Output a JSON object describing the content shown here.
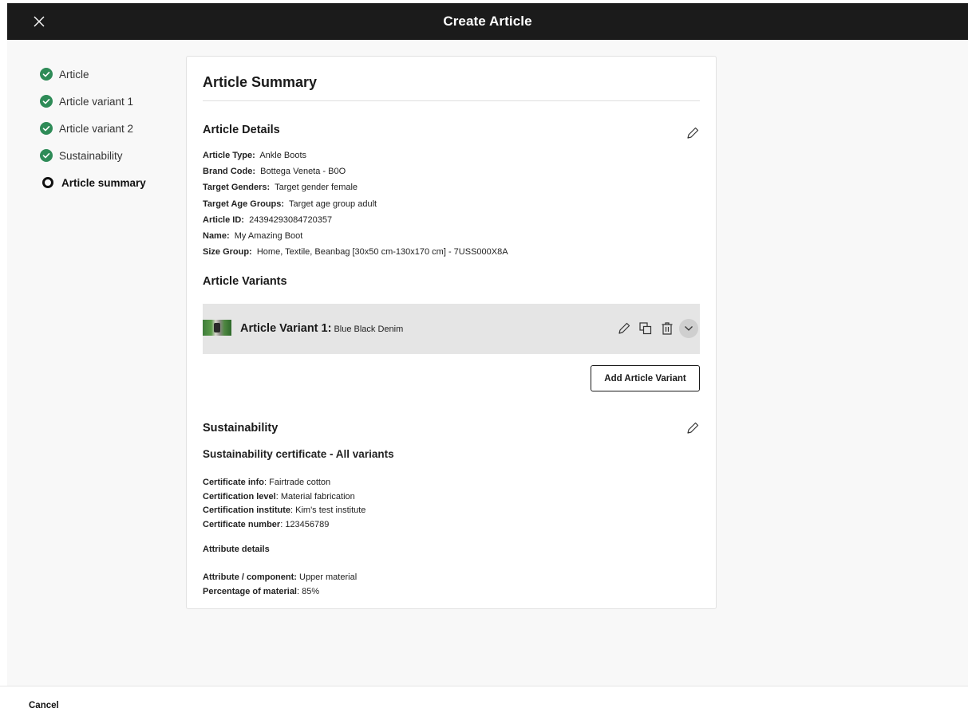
{
  "header": {
    "title": "Create Article"
  },
  "steps": [
    {
      "label": "Article",
      "status": "complete"
    },
    {
      "label": "Article variant 1",
      "status": "complete"
    },
    {
      "label": "Article variant 2",
      "status": "complete"
    },
    {
      "label": "Sustainability",
      "status": "complete"
    },
    {
      "label": "Article summary",
      "status": "current"
    }
  ],
  "summary": {
    "title": "Article Summary",
    "details": {
      "heading": "Article Details",
      "rows": [
        {
          "label": "Article Type:",
          "value": "Ankle Boots"
        },
        {
          "label": "Brand Code:",
          "value": "Bottega Veneta - B0O"
        },
        {
          "label": "Target Genders:",
          "value": "Target gender female"
        },
        {
          "label": "Target Age Groups:",
          "value": "Target age group adult"
        },
        {
          "label": "Article ID:",
          "value": "24394293084720357"
        },
        {
          "label": "Name:",
          "value": "My Amazing Boot"
        },
        {
          "label": "Size Group:",
          "value": "Home, Textile, Beanbag [30x50 cm-130x170 cm] - 7USS000X8A"
        }
      ]
    },
    "variants": {
      "heading": "Article Variants",
      "items": [
        {
          "label": "Article Variant 1:",
          "value": "Blue Black Denim"
        }
      ],
      "add_label": "Add Article Variant"
    },
    "sustainability": {
      "heading": "Sustainability",
      "certificate_heading": "Sustainability certificate - All variants",
      "certificate": [
        {
          "label": "Certificate info",
          "value": ": Fairtrade cotton"
        },
        {
          "label": "Certification level",
          "value": ": Material fabrication"
        },
        {
          "label": "Certification institute",
          "value": ": Kim's test institute"
        },
        {
          "label": "Certificate number",
          "value": ": 123456789"
        }
      ],
      "attribute_heading": "Attribute details",
      "attributes": [
        {
          "label": "Attribute / component:",
          "value": " Upper material"
        },
        {
          "label": "Percentage of material",
          "value": ": 85%"
        }
      ]
    }
  },
  "footer": {
    "cancel_label": "Cancel"
  },
  "colors": {
    "check": "#2e8b57",
    "topbar": "#1b1b1b",
    "variant_bg": "#e5e5e5"
  },
  "icons": [
    "close-icon",
    "check-circle-icon",
    "pencil-icon",
    "duplicate-icon",
    "trash-icon",
    "chevron-down-icon"
  ]
}
